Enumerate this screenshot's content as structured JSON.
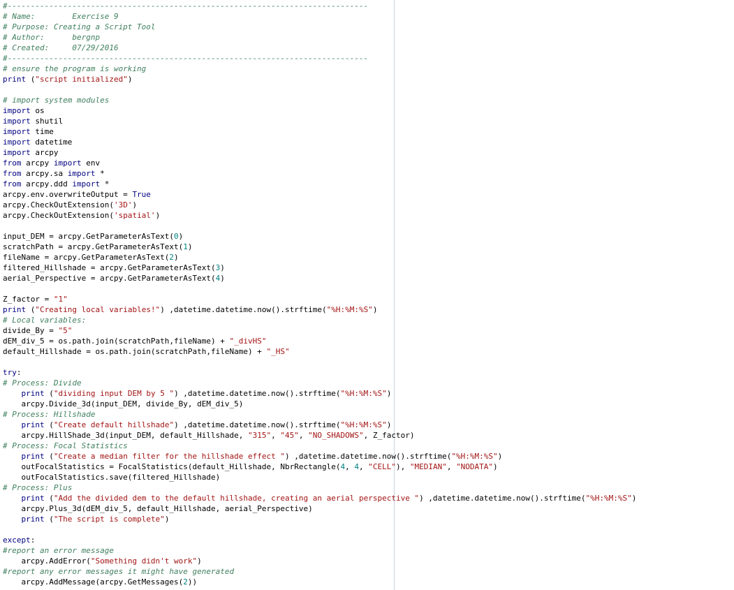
{
  "colors": {
    "background": "#ffffff",
    "comment": "#3f7f5f",
    "keyword": "#000080",
    "string": "#a31515",
    "number": "#008080",
    "text": "#000000",
    "edge_line": "#c9d3e0"
  },
  "lines": [
    [
      [
        "c",
        "#------------------------------------------------------------------------------"
      ]
    ],
    [
      [
        "c",
        "# Name:        Exercise 9"
      ]
    ],
    [
      [
        "c",
        "# Purpose: Creating a Script Tool"
      ]
    ],
    [
      [
        "c",
        "# Author:      bergnp"
      ]
    ],
    [
      [
        "c",
        "# Created:     07/29/2016"
      ]
    ],
    [
      [
        "c",
        "#------------------------------------------------------------------------------"
      ]
    ],
    [
      [
        "c",
        "# ensure the program is working"
      ]
    ],
    [
      [
        "k",
        "print"
      ],
      [
        "p",
        " ("
      ],
      [
        "s",
        "\"script initialized\""
      ],
      [
        "p",
        ")"
      ]
    ],
    [],
    [
      [
        "c",
        "# import system modules"
      ]
    ],
    [
      [
        "k",
        "import"
      ],
      [
        "p",
        " os"
      ]
    ],
    [
      [
        "k",
        "import"
      ],
      [
        "p",
        " shutil"
      ]
    ],
    [
      [
        "k",
        "import"
      ],
      [
        "p",
        " time"
      ]
    ],
    [
      [
        "k",
        "import"
      ],
      [
        "p",
        " datetime"
      ]
    ],
    [
      [
        "k",
        "import"
      ],
      [
        "p",
        " arcpy"
      ]
    ],
    [
      [
        "k",
        "from"
      ],
      [
        "p",
        " arcpy "
      ],
      [
        "k",
        "import"
      ],
      [
        "p",
        " env"
      ]
    ],
    [
      [
        "k",
        "from"
      ],
      [
        "p",
        " arcpy.sa "
      ],
      [
        "k",
        "import"
      ],
      [
        "p",
        " *"
      ]
    ],
    [
      [
        "k",
        "from"
      ],
      [
        "p",
        " arcpy.ddd "
      ],
      [
        "k",
        "import"
      ],
      [
        "p",
        " *"
      ]
    ],
    [
      [
        "p",
        "arcpy.env.overwriteOutput = "
      ],
      [
        "k",
        "True"
      ]
    ],
    [
      [
        "p",
        "arcpy.CheckOutExtension("
      ],
      [
        "s",
        "'3D'"
      ],
      [
        "p",
        ")"
      ]
    ],
    [
      [
        "p",
        "arcpy.CheckOutExtension("
      ],
      [
        "s",
        "'spatial'"
      ],
      [
        "p",
        ")"
      ]
    ],
    [],
    [
      [
        "p",
        "input_DEM = arcpy.GetParameterAsText("
      ],
      [
        "n",
        "0"
      ],
      [
        "p",
        ")"
      ]
    ],
    [
      [
        "p",
        "scratchPath = arcpy.GetParameterAsText("
      ],
      [
        "n",
        "1"
      ],
      [
        "p",
        ")"
      ]
    ],
    [
      [
        "p",
        "fileName = arcpy.GetParameterAsText("
      ],
      [
        "n",
        "2"
      ],
      [
        "p",
        ")"
      ]
    ],
    [
      [
        "p",
        "filtered_Hillshade = arcpy.GetParameterAsText("
      ],
      [
        "n",
        "3"
      ],
      [
        "p",
        ")"
      ]
    ],
    [
      [
        "p",
        "aerial_Perspective = arcpy.GetParameterAsText("
      ],
      [
        "n",
        "4"
      ],
      [
        "p",
        ")"
      ]
    ],
    [],
    [
      [
        "p",
        "Z_factor = "
      ],
      [
        "s",
        "\"1\""
      ]
    ],
    [
      [
        "k",
        "print"
      ],
      [
        "p",
        " ("
      ],
      [
        "s",
        "\"Creating local variables!\""
      ],
      [
        "p",
        ") ,datetime.datetime.now().strftime("
      ],
      [
        "s",
        "\"%H:%M:%S\""
      ],
      [
        "p",
        ")"
      ]
    ],
    [
      [
        "c",
        "# Local variables:"
      ]
    ],
    [
      [
        "p",
        "divide_By = "
      ],
      [
        "s",
        "\"5\""
      ]
    ],
    [
      [
        "p",
        "dEM_div_5 = os.path.join(scratchPath,fileName) + "
      ],
      [
        "s",
        "\"_divHS\""
      ]
    ],
    [
      [
        "p",
        "default_Hillshade = os.path.join(scratchPath,fileName) + "
      ],
      [
        "s",
        "\"_HS\""
      ]
    ],
    [],
    [
      [
        "k",
        "try"
      ],
      [
        "p",
        ":"
      ]
    ],
    [
      [
        "c",
        "# Process: Divide"
      ]
    ],
    [
      [
        "p",
        "    "
      ],
      [
        "k",
        "print"
      ],
      [
        "p",
        " ("
      ],
      [
        "s",
        "\"dividing input DEM by 5 \""
      ],
      [
        "p",
        ") ,datetime.datetime.now().strftime("
      ],
      [
        "s",
        "\"%H:%M:%S\""
      ],
      [
        "p",
        ")"
      ]
    ],
    [
      [
        "p",
        "    arcpy.Divide_3d(input_DEM, divide_By, dEM_div_5)"
      ]
    ],
    [
      [
        "c",
        "# Process: Hillshade"
      ]
    ],
    [
      [
        "p",
        "    "
      ],
      [
        "k",
        "print"
      ],
      [
        "p",
        " ("
      ],
      [
        "s",
        "\"Create default hillshade\""
      ],
      [
        "p",
        ") ,datetime.datetime.now().strftime("
      ],
      [
        "s",
        "\"%H:%M:%S\""
      ],
      [
        "p",
        ")"
      ]
    ],
    [
      [
        "p",
        "    arcpy.HillShade_3d(input_DEM, default_Hillshade, "
      ],
      [
        "s",
        "\"315\""
      ],
      [
        "p",
        ", "
      ],
      [
        "s",
        "\"45\""
      ],
      [
        "p",
        ", "
      ],
      [
        "s",
        "\"NO_SHADOWS\""
      ],
      [
        "p",
        ", Z_factor)"
      ]
    ],
    [
      [
        "c",
        "# Process: Focal Statistics"
      ]
    ],
    [
      [
        "p",
        "    "
      ],
      [
        "k",
        "print"
      ],
      [
        "p",
        " ("
      ],
      [
        "s",
        "\"Create a median filter for the hillshade effect \""
      ],
      [
        "p",
        ") ,datetime.datetime.now().strftime("
      ],
      [
        "s",
        "\"%H:%M:%S\""
      ],
      [
        "p",
        ")"
      ]
    ],
    [
      [
        "p",
        "    outFocalStatistics = FocalStatistics(default_Hillshade, NbrRectangle("
      ],
      [
        "n",
        "4"
      ],
      [
        "p",
        ", "
      ],
      [
        "n",
        "4"
      ],
      [
        "p",
        ", "
      ],
      [
        "s",
        "\"CELL\""
      ],
      [
        "p",
        "), "
      ],
      [
        "s",
        "\"MEDIAN\""
      ],
      [
        "p",
        ", "
      ],
      [
        "s",
        "\"NODATA\""
      ],
      [
        "p",
        ")"
      ]
    ],
    [
      [
        "p",
        "    outFocalStatistics.save(filtered_Hillshade)"
      ]
    ],
    [
      [
        "c",
        "# Process: Plus"
      ]
    ],
    [
      [
        "p",
        "    "
      ],
      [
        "k",
        "print"
      ],
      [
        "p",
        " ("
      ],
      [
        "s",
        "\"Add the divided dem to the default hillshade, creating an aerial perspective \""
      ],
      [
        "p",
        ") ,datetime.datetime.now().strftime("
      ],
      [
        "s",
        "\"%H:%M:%S\""
      ],
      [
        "p",
        ")"
      ]
    ],
    [
      [
        "p",
        "    arcpy.Plus_3d(dEM_div_5, default_Hillshade, aerial_Perspective)"
      ]
    ],
    [
      [
        "p",
        "    "
      ],
      [
        "k",
        "print"
      ],
      [
        "p",
        " ("
      ],
      [
        "s",
        "\"The script is complete\""
      ],
      [
        "p",
        ")"
      ]
    ],
    [],
    [
      [
        "k",
        "except"
      ],
      [
        "p",
        ":"
      ]
    ],
    [
      [
        "c",
        "#report an error message"
      ]
    ],
    [
      [
        "p",
        "    arcpy.AddError("
      ],
      [
        "s",
        "\"Something didn't work\""
      ],
      [
        "p",
        ")"
      ]
    ],
    [
      [
        "c",
        "#report any error messages it might have generated"
      ]
    ],
    [
      [
        "p",
        "    arcpy.AddMessage(arcpy.GetMessages("
      ],
      [
        "n",
        "2"
      ],
      [
        "p",
        "))"
      ]
    ]
  ]
}
